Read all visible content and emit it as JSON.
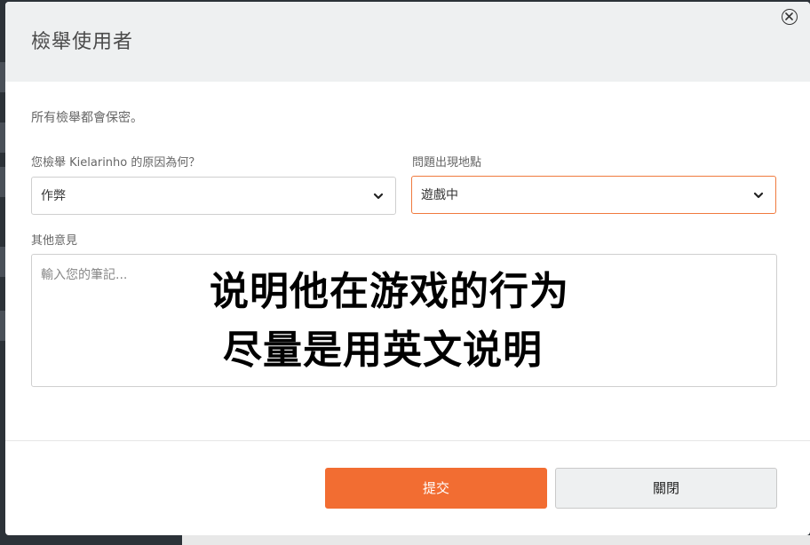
{
  "modal": {
    "title": "檢舉使用者",
    "privacy_note": "所有檢舉都會保密。"
  },
  "form": {
    "reason_label": "您檢舉 Kielarinho 的原因為何？",
    "reason_value": "作弊",
    "location_label": "問題出現地點",
    "location_value": "遊戲中",
    "comments_label": "其他意見",
    "comments_placeholder": "輸入您的筆記..."
  },
  "overlay": {
    "line1": "说明他在游戏的行为",
    "line2": "尽量是用英文说明"
  },
  "buttons": {
    "submit_label": "提交",
    "close_label": "關閉"
  },
  "colors": {
    "accent": "#f26d32",
    "focus_border": "#f07a3e",
    "header_bg": "#eef0f1"
  },
  "icons": {
    "close": "close-circle-icon",
    "dropdown": "chevron-down-icon"
  }
}
